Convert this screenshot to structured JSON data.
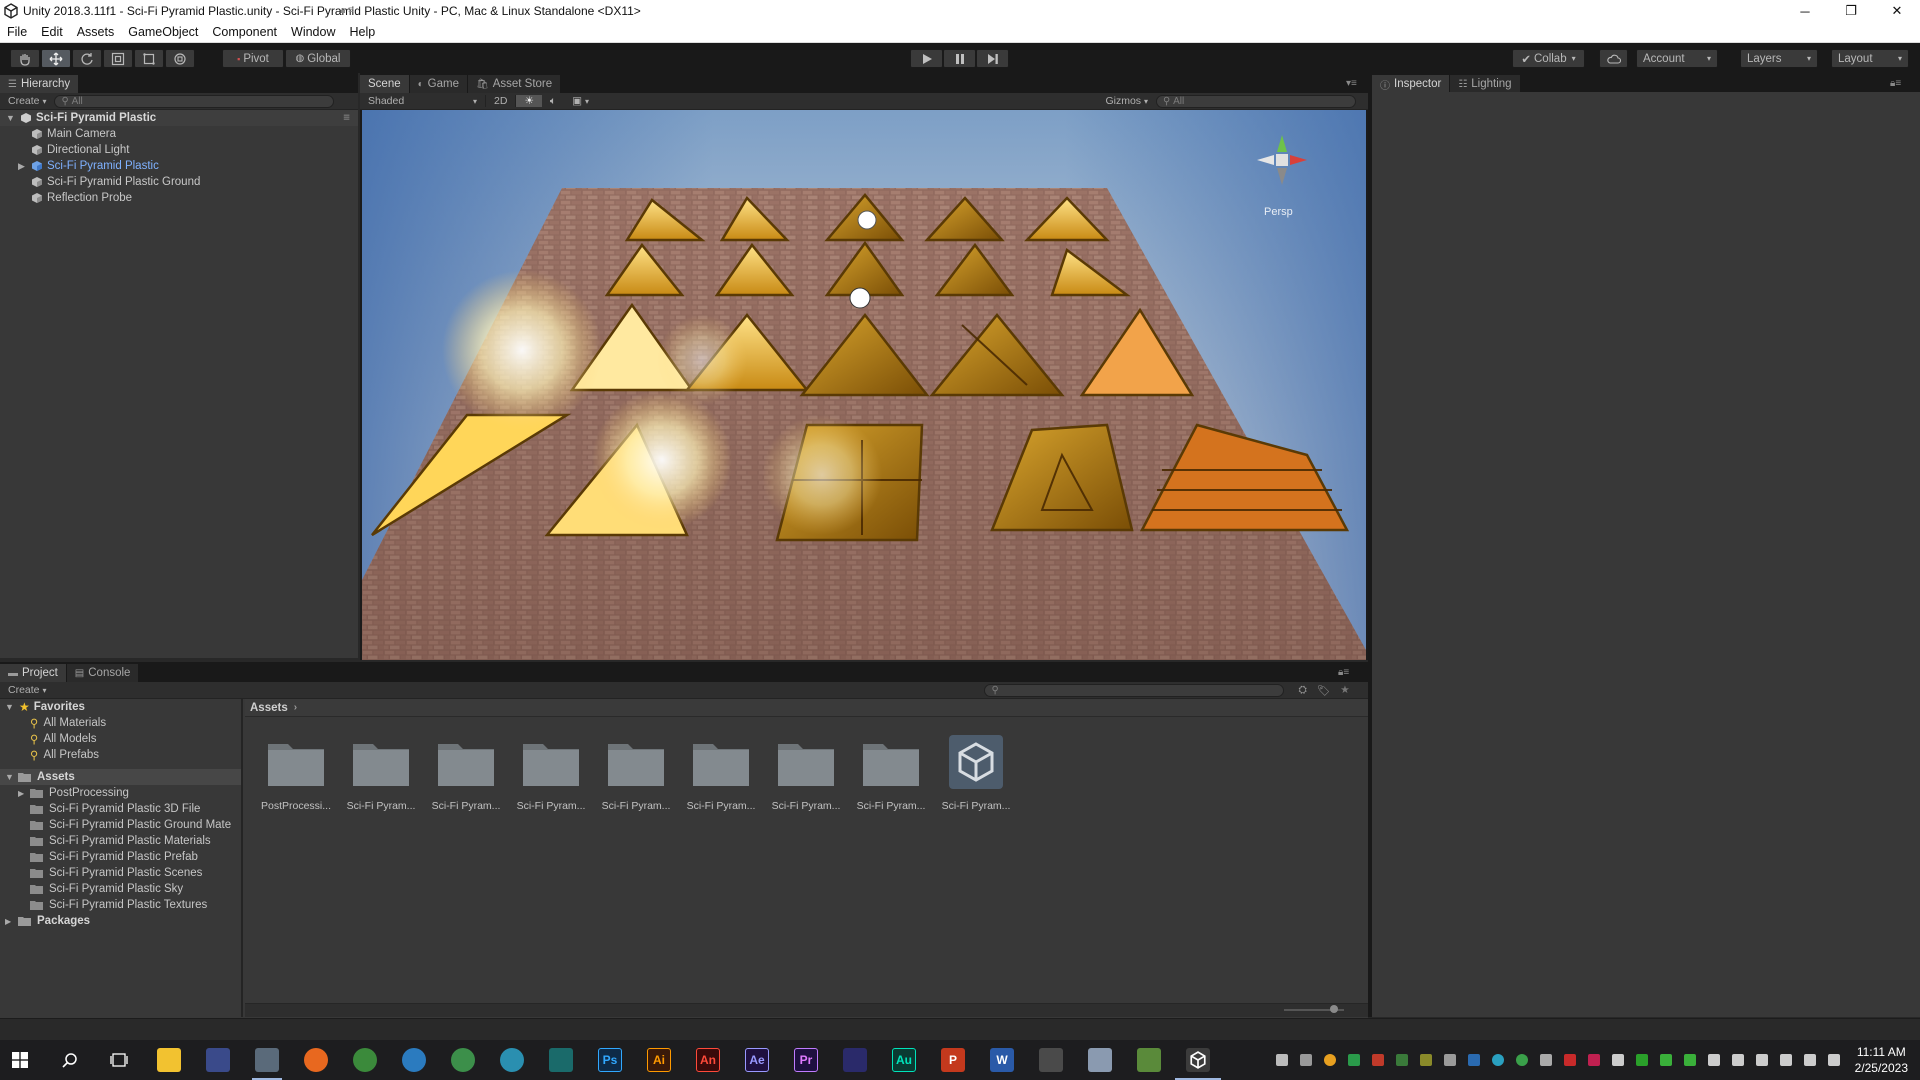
{
  "window": {
    "title": "Unity 2018.3.11f1 - Sci-Fi Pyramid Plastic.unity - Sci-Fi Pyramid Plastic Unity - PC, Mac & Linux Standalone <DX11>",
    "controls": {
      "minimize": "─",
      "maximize": "❐",
      "close": "✕"
    }
  },
  "menu": [
    "File",
    "Edit",
    "Assets",
    "GameObject",
    "Component",
    "Window",
    "Help"
  ],
  "toolbar": {
    "pivot": "Pivot",
    "global": "Global",
    "collab": "Collab",
    "account": "Account",
    "layers": "Layers",
    "layout": "Layout"
  },
  "hierarchy": {
    "tab": "Hierarchy",
    "create": "Create",
    "search_placeholder": "All",
    "scene": "Sci-Fi Pyramid Plastic",
    "items": [
      "Main Camera",
      "Directional Light",
      "Sci-Fi Pyramid Plastic",
      "Sci-Fi Pyramid Plastic Ground",
      "Reflection Probe"
    ]
  },
  "scene_tabs": {
    "scene": "Scene",
    "game": "Game",
    "store": "Asset Store",
    "shading": "Shaded",
    "mode2d": "2D",
    "gizmos": "Gizmos",
    "search_placeholder": "All",
    "persp": "Persp"
  },
  "inspector_tabs": {
    "inspector": "Inspector",
    "lighting": "Lighting"
  },
  "project": {
    "tab_project": "Project",
    "tab_console": "Console",
    "create": "Create",
    "favorites": "Favorites",
    "favorite_items": [
      "All Materials",
      "All Models",
      "All Prefabs"
    ],
    "assets": "Assets",
    "asset_folders": [
      "PostProcessing",
      "Sci-Fi Pyramid Plastic 3D File",
      "Sci-Fi Pyramid Plastic Ground Mate",
      "Sci-Fi Pyramid Plastic Materials",
      "Sci-Fi Pyramid Plastic Prefab",
      "Sci-Fi Pyramid Plastic Scenes",
      "Sci-Fi Pyramid Plastic Sky",
      "Sci-Fi Pyramid Plastic Textures"
    ],
    "packages": "Packages",
    "breadcrumb": "Assets",
    "tiles": [
      "PostProcessi...",
      "Sci-Fi Pyram...",
      "Sci-Fi Pyram...",
      "Sci-Fi Pyram...",
      "Sci-Fi Pyram...",
      "Sci-Fi Pyram...",
      "Sci-Fi Pyram...",
      "Sci-Fi Pyram...",
      "Sci-Fi Pyram..."
    ]
  },
  "taskbar": {
    "time": "11:11 AM",
    "date": "2/25/2023",
    "apps": [
      {
        "name": "file-explorer",
        "label": "",
        "color": "#f2c230"
      },
      {
        "name": "blender-like",
        "label": "",
        "color": "#3a4a8a"
      },
      {
        "name": "app-3",
        "label": "",
        "color": "#5a6a7a"
      },
      {
        "name": "firefox",
        "label": "",
        "color": "#e8681f"
      },
      {
        "name": "chrome",
        "label": "",
        "color": "#3b8a3b"
      },
      {
        "name": "search-app",
        "label": "",
        "color": "#2b7bbf"
      },
      {
        "name": "app-7",
        "label": "",
        "color": "#3c8f4a"
      },
      {
        "name": "app-8",
        "label": "",
        "color": "#2a8fb0"
      },
      {
        "name": "app-9",
        "label": "",
        "color": "#1a6a6a"
      },
      {
        "name": "photoshop",
        "label": "Ps",
        "color": "#0e2a47"
      },
      {
        "name": "illustrator",
        "label": "Ai",
        "color": "#3a1a0a"
      },
      {
        "name": "animate",
        "label": "An",
        "color": "#3a0a0a"
      },
      {
        "name": "after-effects",
        "label": "Ae",
        "color": "#1f1040"
      },
      {
        "name": "premiere",
        "label": "Pr",
        "color": "#1f1040"
      },
      {
        "name": "app-15",
        "label": "",
        "color": "#2a2a6a"
      },
      {
        "name": "audition",
        "label": "Au",
        "color": "#0a3a32"
      },
      {
        "name": "powerpoint",
        "label": "P",
        "color": "#c4391d"
      },
      {
        "name": "word",
        "label": "W",
        "color": "#2a5aa8"
      },
      {
        "name": "sublime",
        "label": "",
        "color": "#4a4a4a"
      },
      {
        "name": "app-20",
        "label": "",
        "color": "#8a9ab0"
      },
      {
        "name": "app-21",
        "label": "",
        "color": "#5a8a3a"
      },
      {
        "name": "unity",
        "label": "",
        "color": "#2a2a2a"
      }
    ]
  }
}
